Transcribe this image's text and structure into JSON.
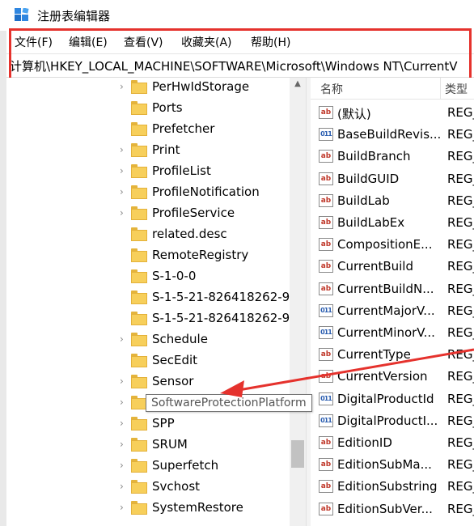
{
  "window": {
    "title": "注册表编辑器"
  },
  "menu": [
    "文件(F)",
    "编辑(E)",
    "查看(V)",
    "收藏夹(A)",
    "帮助(H)"
  ],
  "address": {
    "path": "计算机\\HKEY_LOCAL_MACHINE\\SOFTWARE\\Microsoft\\Windows NT\\CurrentV"
  },
  "tree": {
    "items": [
      {
        "label": "PerHwIdStorage",
        "expandable": true
      },
      {
        "label": "Ports",
        "expandable": false
      },
      {
        "label": "Prefetcher",
        "expandable": false
      },
      {
        "label": "Print",
        "expandable": true
      },
      {
        "label": "ProfileList",
        "expandable": true
      },
      {
        "label": "ProfileNotification",
        "expandable": true
      },
      {
        "label": "ProfileService",
        "expandable": true
      },
      {
        "label": "related.desc",
        "expandable": false
      },
      {
        "label": "RemoteRegistry",
        "expandable": false
      },
      {
        "label": "S-1-0-0",
        "expandable": false
      },
      {
        "label": "S-1-5-21-826418262-9",
        "expandable": false
      },
      {
        "label": "S-1-5-21-826418262-9",
        "expandable": false
      },
      {
        "label": "Schedule",
        "expandable": true
      },
      {
        "label": "SecEdit",
        "expandable": false
      },
      {
        "label": "Sensor",
        "expandable": true
      },
      {
        "label": "SoftwareProtectionPlatform",
        "expandable": true
      },
      {
        "label": "SPP",
        "expandable": true
      },
      {
        "label": "SRUM",
        "expandable": true
      },
      {
        "label": "Superfetch",
        "expandable": true
      },
      {
        "label": "Svchost",
        "expandable": true
      },
      {
        "label": "SystemRestore",
        "expandable": true
      }
    ],
    "tooltip": "SoftwareProtectionPlatform"
  },
  "list": {
    "columns": {
      "name": "名称",
      "type": "类型"
    },
    "rows": [
      {
        "icon": "string-value-icon",
        "name": "(默认)",
        "type": "REG_"
      },
      {
        "icon": "binary-value-icon",
        "name": "BaseBuildRevis...",
        "type": "REG_"
      },
      {
        "icon": "string-value-icon",
        "name": "BuildBranch",
        "type": "REG_"
      },
      {
        "icon": "string-value-icon",
        "name": "BuildGUID",
        "type": "REG_"
      },
      {
        "icon": "string-value-icon",
        "name": "BuildLab",
        "type": "REG_"
      },
      {
        "icon": "string-value-icon",
        "name": "BuildLabEx",
        "type": "REG_"
      },
      {
        "icon": "string-value-icon",
        "name": "CompositionE...",
        "type": "REG_"
      },
      {
        "icon": "string-value-icon",
        "name": "CurrentBuild",
        "type": "REG_"
      },
      {
        "icon": "string-value-icon",
        "name": "CurrentBuildN...",
        "type": "REG_"
      },
      {
        "icon": "binary-value-icon",
        "name": "CurrentMajorV...",
        "type": "REG_"
      },
      {
        "icon": "binary-value-icon",
        "name": "CurrentMinorV...",
        "type": "REG_"
      },
      {
        "icon": "string-value-icon",
        "name": "CurrentType",
        "type": "REG_"
      },
      {
        "icon": "string-value-icon",
        "name": "CurrentVersion",
        "type": "REG_"
      },
      {
        "icon": "binary-value-icon",
        "name": "DigitalProductId",
        "type": "REG_"
      },
      {
        "icon": "binary-value-icon",
        "name": "DigitalProductI...",
        "type": "REG_"
      },
      {
        "icon": "string-value-icon",
        "name": "EditionID",
        "type": "REG_"
      },
      {
        "icon": "string-value-icon",
        "name": "EditionSubMa...",
        "type": "REG_"
      },
      {
        "icon": "string-value-icon",
        "name": "EditionSubstring",
        "type": "REG_"
      },
      {
        "icon": "string-value-icon",
        "name": "EditionSubVer...",
        "type": "REG_"
      }
    ]
  },
  "colors": {
    "highlight": "#e5322d",
    "folder": "#f7cf5b"
  },
  "icons": {
    "string_glyph": "ab",
    "binary_glyph": "011"
  }
}
